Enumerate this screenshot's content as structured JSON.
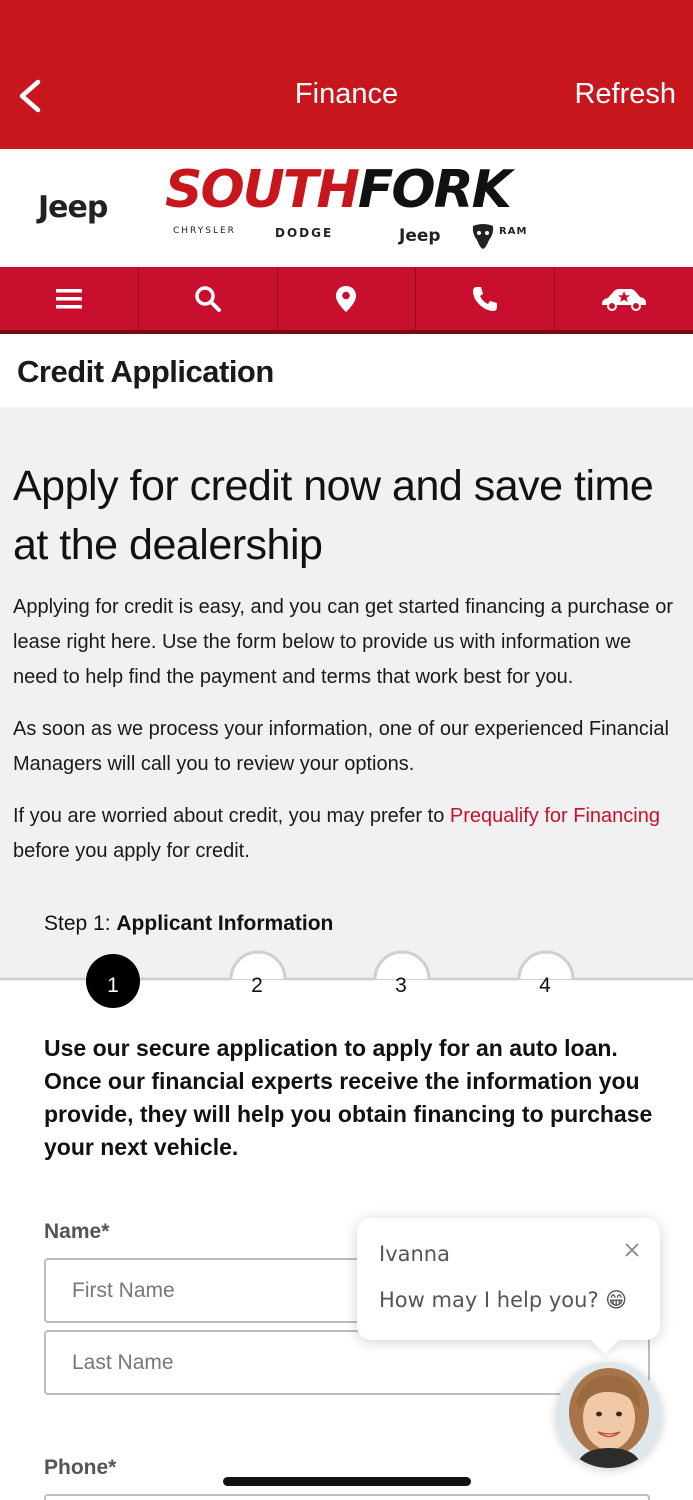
{
  "topbar": {
    "back_icon": "chevron-left-icon",
    "title": "Finance",
    "refresh_label": "Refresh"
  },
  "logo": {
    "left_brand": "Jeep",
    "word_south": "SOUTH",
    "word_fork": "FORK",
    "brands": {
      "chrysler": "CHRYSLER",
      "dodge": "DODGE",
      "jeep": "Jeep",
      "ram": "RAM"
    }
  },
  "navbar": {
    "icons": [
      "menu-icon",
      "search-icon",
      "location-pin-icon",
      "phone-icon",
      "car-star-icon"
    ],
    "color": "#c8102e"
  },
  "page": {
    "title": "Credit Application"
  },
  "content": {
    "headline": "Apply for credit now and save time at the dealership",
    "p1": "Applying for credit is easy, and you can get started financing a purchase or lease right here. Use the form below to provide us with information we need to help find the payment and terms that work best for you.",
    "p2": "As soon as we process your information, one of our experienced Financial Managers will call you to review your options.",
    "p3_before": "If you are worried about credit, you may prefer to ",
    "p3_link": "Prequalify for Financing",
    "p3_after": "before you apply for credit.",
    "step_prefix": "Step 1: ",
    "step_name": "Applicant Information"
  },
  "stepper": {
    "steps": [
      "1",
      "2",
      "3",
      "4"
    ],
    "active": 1
  },
  "form": {
    "intro": "Use our secure application to apply for an auto loan. Once our financial experts receive the information you provide, they will help you obtain financing to purchase your next vehicle.",
    "name_label": "Name*",
    "first_placeholder": "First Name",
    "last_placeholder": "Last Name",
    "phone_label": "Phone*"
  },
  "chat": {
    "agent_name": "Ivanna",
    "message": "How may I help you? 😁",
    "close_icon": "close-icon",
    "avatar_icon": "agent-avatar-icon"
  },
  "colors": {
    "brand_red": "#c8161d",
    "link_red": "#c8102e"
  }
}
